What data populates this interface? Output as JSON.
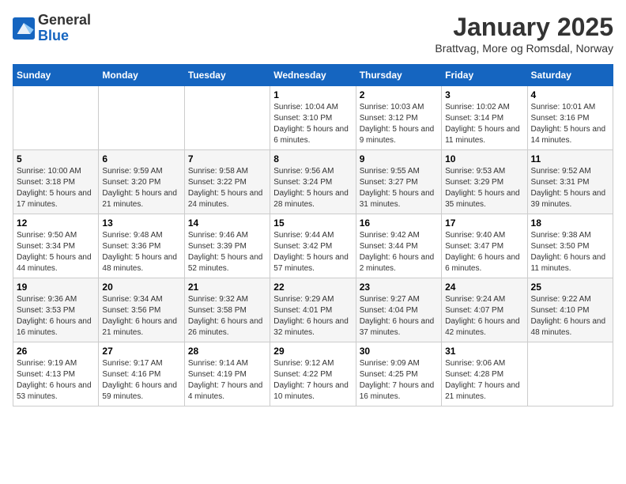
{
  "header": {
    "logo": {
      "general": "General",
      "blue": "Blue"
    },
    "title": "January 2025",
    "subtitle": "Brattvag, More og Romsdal, Norway"
  },
  "calendar": {
    "days_of_week": [
      "Sunday",
      "Monday",
      "Tuesday",
      "Wednesday",
      "Thursday",
      "Friday",
      "Saturday"
    ],
    "weeks": [
      [
        {
          "day": "",
          "info": ""
        },
        {
          "day": "",
          "info": ""
        },
        {
          "day": "",
          "info": ""
        },
        {
          "day": "1",
          "info": "Sunrise: 10:04 AM\nSunset: 3:10 PM\nDaylight: 5 hours and 6 minutes."
        },
        {
          "day": "2",
          "info": "Sunrise: 10:03 AM\nSunset: 3:12 PM\nDaylight: 5 hours and 9 minutes."
        },
        {
          "day": "3",
          "info": "Sunrise: 10:02 AM\nSunset: 3:14 PM\nDaylight: 5 hours and 11 minutes."
        },
        {
          "day": "4",
          "info": "Sunrise: 10:01 AM\nSunset: 3:16 PM\nDaylight: 5 hours and 14 minutes."
        }
      ],
      [
        {
          "day": "5",
          "info": "Sunrise: 10:00 AM\nSunset: 3:18 PM\nDaylight: 5 hours and 17 minutes."
        },
        {
          "day": "6",
          "info": "Sunrise: 9:59 AM\nSunset: 3:20 PM\nDaylight: 5 hours and 21 minutes."
        },
        {
          "day": "7",
          "info": "Sunrise: 9:58 AM\nSunset: 3:22 PM\nDaylight: 5 hours and 24 minutes."
        },
        {
          "day": "8",
          "info": "Sunrise: 9:56 AM\nSunset: 3:24 PM\nDaylight: 5 hours and 28 minutes."
        },
        {
          "day": "9",
          "info": "Sunrise: 9:55 AM\nSunset: 3:27 PM\nDaylight: 5 hours and 31 minutes."
        },
        {
          "day": "10",
          "info": "Sunrise: 9:53 AM\nSunset: 3:29 PM\nDaylight: 5 hours and 35 minutes."
        },
        {
          "day": "11",
          "info": "Sunrise: 9:52 AM\nSunset: 3:31 PM\nDaylight: 5 hours and 39 minutes."
        }
      ],
      [
        {
          "day": "12",
          "info": "Sunrise: 9:50 AM\nSunset: 3:34 PM\nDaylight: 5 hours and 44 minutes."
        },
        {
          "day": "13",
          "info": "Sunrise: 9:48 AM\nSunset: 3:36 PM\nDaylight: 5 hours and 48 minutes."
        },
        {
          "day": "14",
          "info": "Sunrise: 9:46 AM\nSunset: 3:39 PM\nDaylight: 5 hours and 52 minutes."
        },
        {
          "day": "15",
          "info": "Sunrise: 9:44 AM\nSunset: 3:42 PM\nDaylight: 5 hours and 57 minutes."
        },
        {
          "day": "16",
          "info": "Sunrise: 9:42 AM\nSunset: 3:44 PM\nDaylight: 6 hours and 2 minutes."
        },
        {
          "day": "17",
          "info": "Sunrise: 9:40 AM\nSunset: 3:47 PM\nDaylight: 6 hours and 6 minutes."
        },
        {
          "day": "18",
          "info": "Sunrise: 9:38 AM\nSunset: 3:50 PM\nDaylight: 6 hours and 11 minutes."
        }
      ],
      [
        {
          "day": "19",
          "info": "Sunrise: 9:36 AM\nSunset: 3:53 PM\nDaylight: 6 hours and 16 minutes."
        },
        {
          "day": "20",
          "info": "Sunrise: 9:34 AM\nSunset: 3:56 PM\nDaylight: 6 hours and 21 minutes."
        },
        {
          "day": "21",
          "info": "Sunrise: 9:32 AM\nSunset: 3:58 PM\nDaylight: 6 hours and 26 minutes."
        },
        {
          "day": "22",
          "info": "Sunrise: 9:29 AM\nSunset: 4:01 PM\nDaylight: 6 hours and 32 minutes."
        },
        {
          "day": "23",
          "info": "Sunrise: 9:27 AM\nSunset: 4:04 PM\nDaylight: 6 hours and 37 minutes."
        },
        {
          "day": "24",
          "info": "Sunrise: 9:24 AM\nSunset: 4:07 PM\nDaylight: 6 hours and 42 minutes."
        },
        {
          "day": "25",
          "info": "Sunrise: 9:22 AM\nSunset: 4:10 PM\nDaylight: 6 hours and 48 minutes."
        }
      ],
      [
        {
          "day": "26",
          "info": "Sunrise: 9:19 AM\nSunset: 4:13 PM\nDaylight: 6 hours and 53 minutes."
        },
        {
          "day": "27",
          "info": "Sunrise: 9:17 AM\nSunset: 4:16 PM\nDaylight: 6 hours and 59 minutes."
        },
        {
          "day": "28",
          "info": "Sunrise: 9:14 AM\nSunset: 4:19 PM\nDaylight: 7 hours and 4 minutes."
        },
        {
          "day": "29",
          "info": "Sunrise: 9:12 AM\nSunset: 4:22 PM\nDaylight: 7 hours and 10 minutes."
        },
        {
          "day": "30",
          "info": "Sunrise: 9:09 AM\nSunset: 4:25 PM\nDaylight: 7 hours and 16 minutes."
        },
        {
          "day": "31",
          "info": "Sunrise: 9:06 AM\nSunset: 4:28 PM\nDaylight: 7 hours and 21 minutes."
        },
        {
          "day": "",
          "info": ""
        }
      ]
    ]
  }
}
